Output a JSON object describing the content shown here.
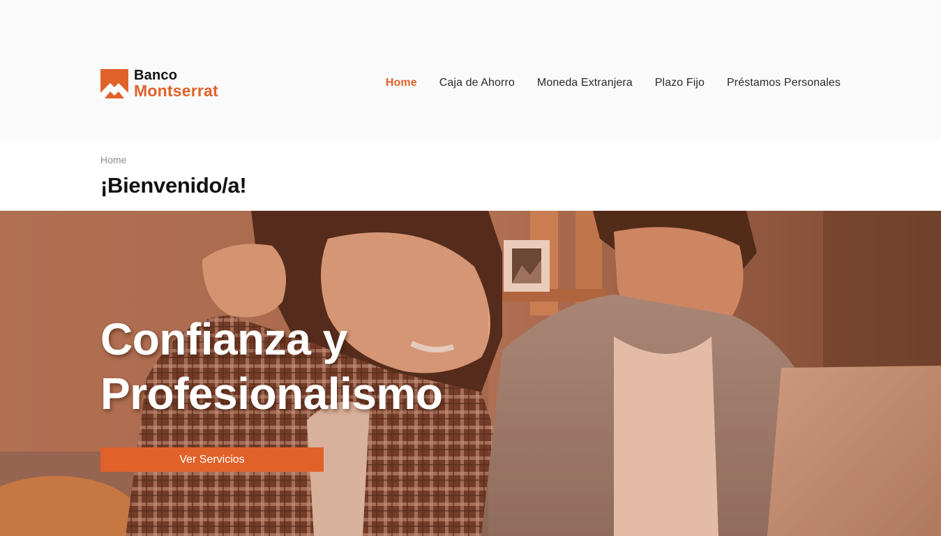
{
  "brand": {
    "line1": "Banco",
    "line2": "Montserrat",
    "accent_color": "#e0622a",
    "icon": "mountain-logo-icon"
  },
  "nav": {
    "items": [
      {
        "label": "Home",
        "active": true
      },
      {
        "label": "Caja de Ahorro",
        "active": false
      },
      {
        "label": "Moneda Extranjera",
        "active": false
      },
      {
        "label": "Plazo Fijo",
        "active": false
      },
      {
        "label": "Préstamos Personales",
        "active": false
      }
    ]
  },
  "page": {
    "breadcrumb": "Home",
    "title": "¡Bienvenido/a!"
  },
  "hero": {
    "heading_line1": "Confianza y",
    "heading_line2": "Profesionalismo",
    "cta_label": "Ver Servicios"
  }
}
